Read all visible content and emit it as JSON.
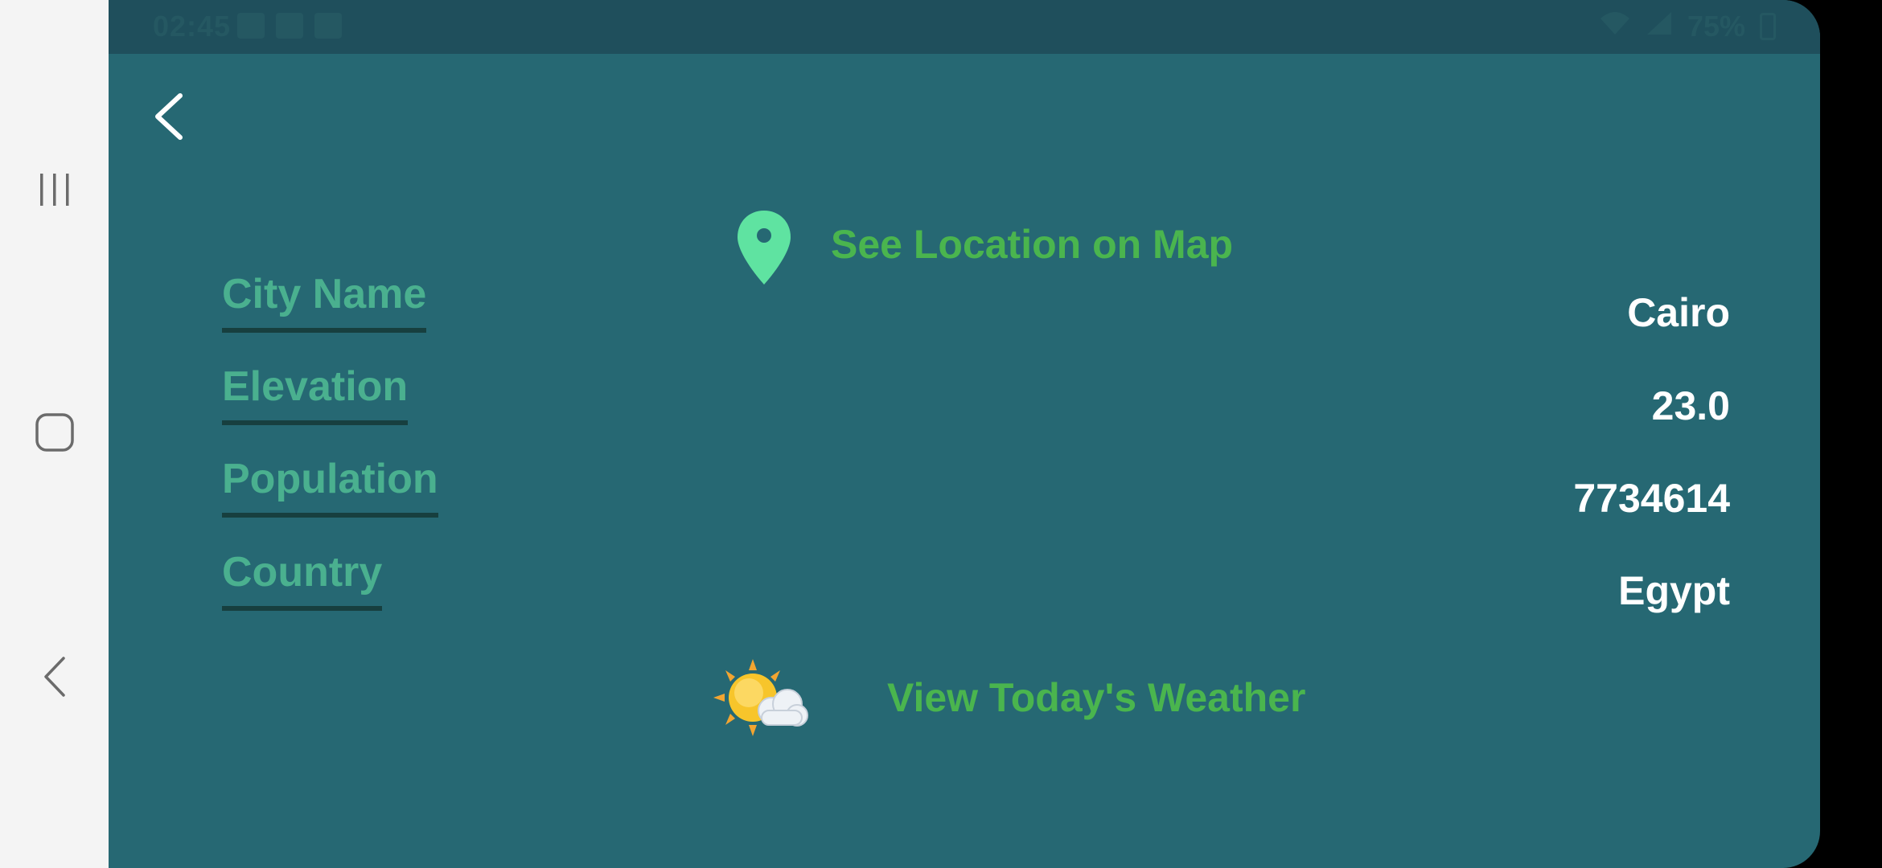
{
  "status_bar": {
    "time": "02:45",
    "battery": "75%"
  },
  "system_nav": {
    "recents_icon": "recents-icon",
    "home_icon": "home-icon",
    "back_icon": "back-icon"
  },
  "header": {
    "back_icon": "chevron-left-icon"
  },
  "actions": {
    "map_link_label": "See Location on Map",
    "map_icon": "map-pin-icon",
    "weather_link_label": "View Today's Weather",
    "weather_icon": "sun-behind-cloud-icon"
  },
  "fields": [
    {
      "label": "City Name",
      "value": "Cairo"
    },
    {
      "label": "Elevation",
      "value": "23.0"
    },
    {
      "label": "Population",
      "value": "7734614"
    },
    {
      "label": "Country",
      "value": "Egypt"
    }
  ],
  "colors": {
    "app_background": "#266873",
    "status_bar": "#1f4f5c",
    "label_text": "#4ab08f",
    "link_text": "#4ab54e",
    "value_text": "#ffffff",
    "pin": "#5fe3a1",
    "nav_bar": "#f4f4f4"
  }
}
